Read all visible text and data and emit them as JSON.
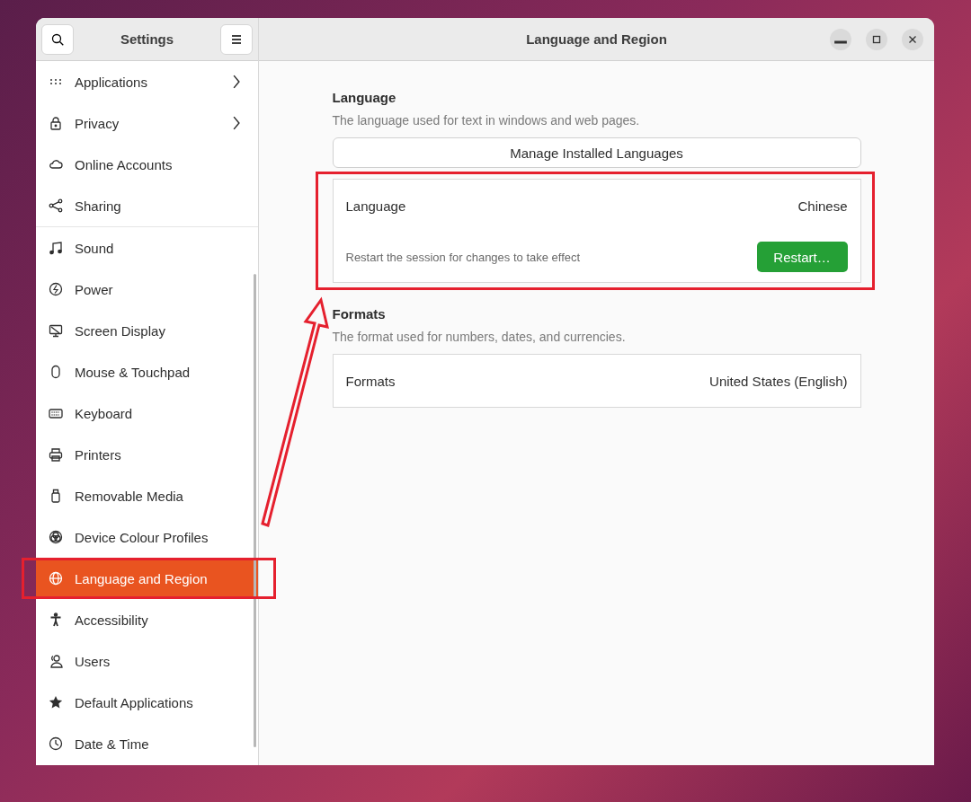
{
  "sidebar": {
    "title": "Settings",
    "groups": [
      [
        {
          "label": "Applications",
          "submenu": true,
          "selected": false
        },
        {
          "label": "Privacy",
          "submenu": true,
          "selected": false
        },
        {
          "label": "Online Accounts",
          "submenu": false,
          "selected": false
        },
        {
          "label": "Sharing",
          "submenu": false,
          "selected": false
        }
      ],
      [
        {
          "label": "Sound",
          "submenu": false,
          "selected": false
        },
        {
          "label": "Power",
          "submenu": false,
          "selected": false
        },
        {
          "label": "Screen Display",
          "submenu": false,
          "selected": false
        },
        {
          "label": "Mouse & Touchpad",
          "submenu": false,
          "selected": false
        },
        {
          "label": "Keyboard",
          "submenu": false,
          "selected": false
        },
        {
          "label": "Printers",
          "submenu": false,
          "selected": false
        },
        {
          "label": "Removable Media",
          "submenu": false,
          "selected": false
        },
        {
          "label": "Device Colour Profiles",
          "submenu": false,
          "selected": false
        },
        {
          "label": "Language and Region",
          "submenu": false,
          "selected": true
        },
        {
          "label": "Accessibility",
          "submenu": false,
          "selected": false
        },
        {
          "label": "Users",
          "submenu": false,
          "selected": false
        },
        {
          "label": "Default Applications",
          "submenu": false,
          "selected": false
        },
        {
          "label": "Date & Time",
          "submenu": false,
          "selected": false
        }
      ]
    ]
  },
  "window": {
    "title": "Language and Region"
  },
  "sections": [
    {
      "heading": "Language",
      "description": "The language used for text in windows and web pages.",
      "button": "Manage Installed Languages",
      "card": {
        "label": "Language",
        "value": "Chinese",
        "note": "Restart the session for changes to take effect",
        "action": "Restart…"
      }
    },
    {
      "heading": "Formats",
      "description": "The format used for numbers, dates, and currencies.",
      "card": {
        "label": "Formats",
        "value": "United States (English)"
      }
    }
  ],
  "annotations": [
    {
      "kind": "highlight-box"
    },
    {
      "kind": "highlight-box"
    },
    {
      "kind": "arrow"
    }
  ]
}
